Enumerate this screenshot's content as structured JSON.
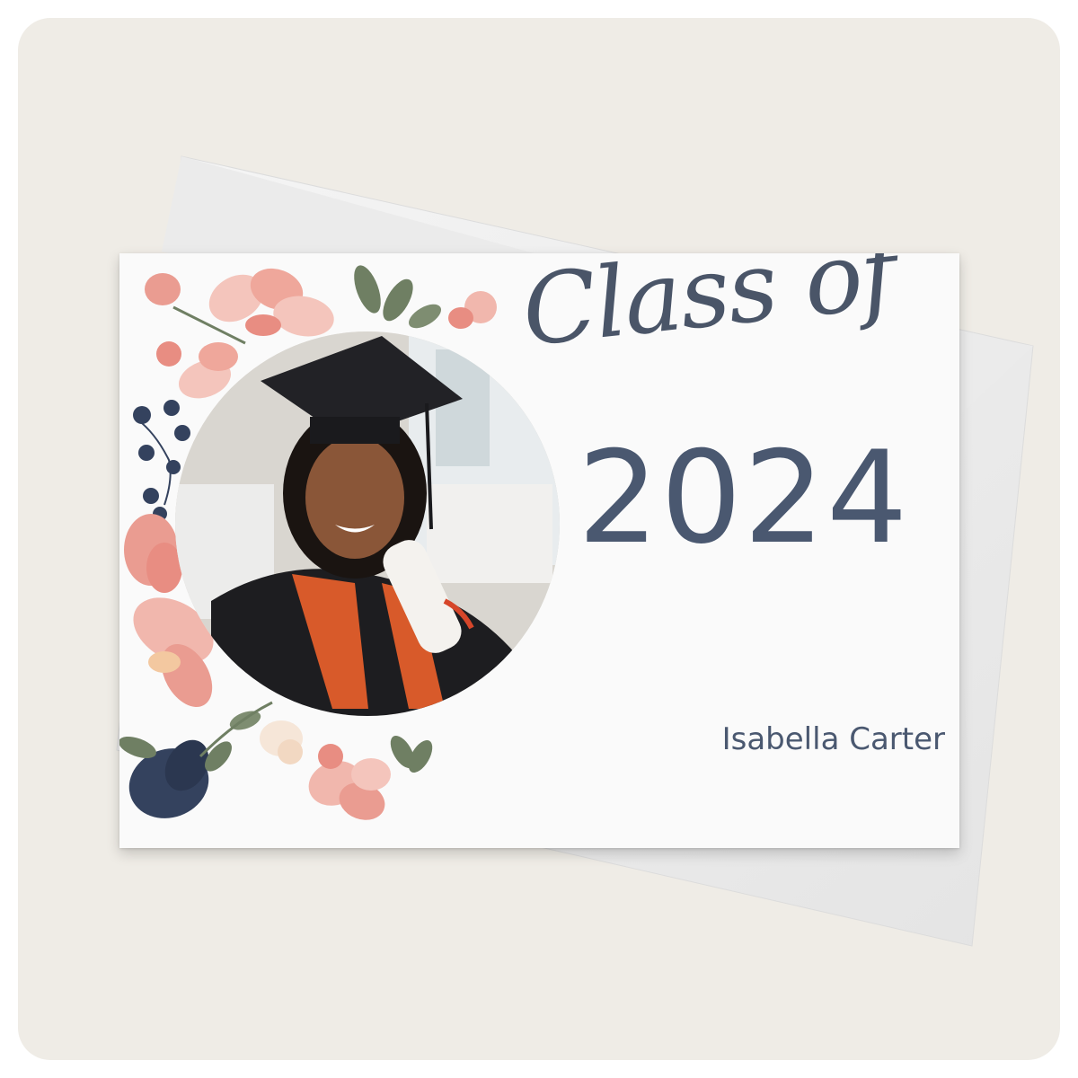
{
  "card": {
    "heading_script": "Class of",
    "year": "2024",
    "name": "Isabella Carter"
  },
  "colors": {
    "background": "#efece6",
    "text": "#4a5870",
    "pink": "#f1b7ad",
    "coral": "#e88d82",
    "navy": "#34425e",
    "leaf": "#6f7f63"
  },
  "icons": {
    "flower": "pink-flower-icon",
    "leaf": "leaf-icon",
    "berry": "navy-berry-icon"
  }
}
